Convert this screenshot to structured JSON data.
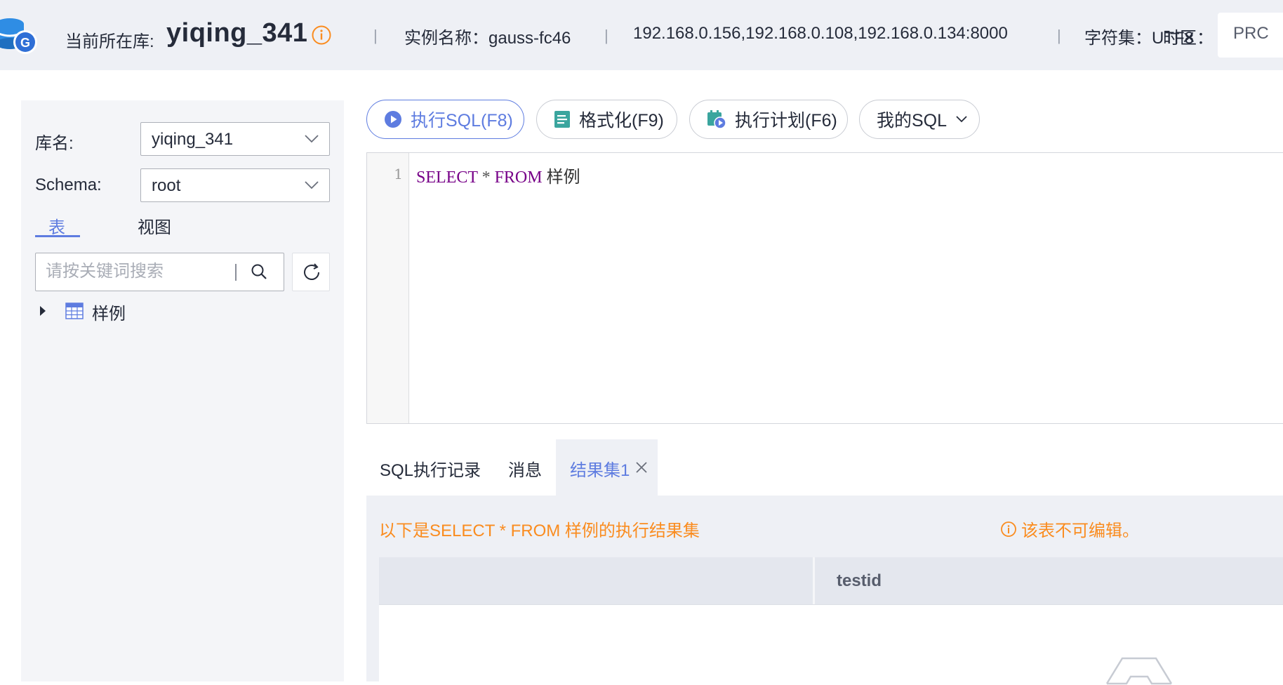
{
  "header": {
    "current_db_label": "当前所在库:",
    "current_db": "yiqing_341",
    "instance": "实例名称：gauss-fc46",
    "hosts": "192.168.0.156,192.168.0.108,192.168.0.134:8000",
    "charset": "字符集：UTF8",
    "timezone_label": "时区：",
    "timezone_value": "PRC",
    "separator": "|",
    "logo_icon": "gaussdb-logo-icon",
    "info_icon": "info-circle-icon",
    "colors": {
      "bg": "#eef0f5",
      "info": "#fa8c1f"
    }
  },
  "sidebar": {
    "db_label": "库名:",
    "db_value": "yiqing_341",
    "schema_label": "Schema:",
    "schema_value": "root",
    "tabs": [
      {
        "label": "表",
        "active": true
      },
      {
        "label": "视图",
        "active": false
      }
    ],
    "search_placeholder": "请按关键词搜索",
    "tree": [
      {
        "label": "样例",
        "icon": "table-icon",
        "expanded": false
      }
    ]
  },
  "toolbar": {
    "execute_sql": "执行SQL(F8)",
    "format": "格式化(F9)",
    "exec_plan": "执行计划(F6)",
    "my_sql": "我的SQL",
    "accent": "#5e7ce0"
  },
  "editor": {
    "line_number": "1",
    "tokens": {
      "select": "SELECT",
      "star": "*",
      "from": "FROM",
      "table": "样例"
    }
  },
  "result_tabs": [
    {
      "label": "SQL执行记录",
      "active": false
    },
    {
      "label": "消息",
      "active": false
    },
    {
      "label": "结果集1",
      "active": true
    }
  ],
  "result": {
    "notice": "以下是SELECT * FROM 样例的执行结果集",
    "readonly_notice": "该表不可编辑。",
    "columns": [
      "testid"
    ],
    "rows": []
  }
}
